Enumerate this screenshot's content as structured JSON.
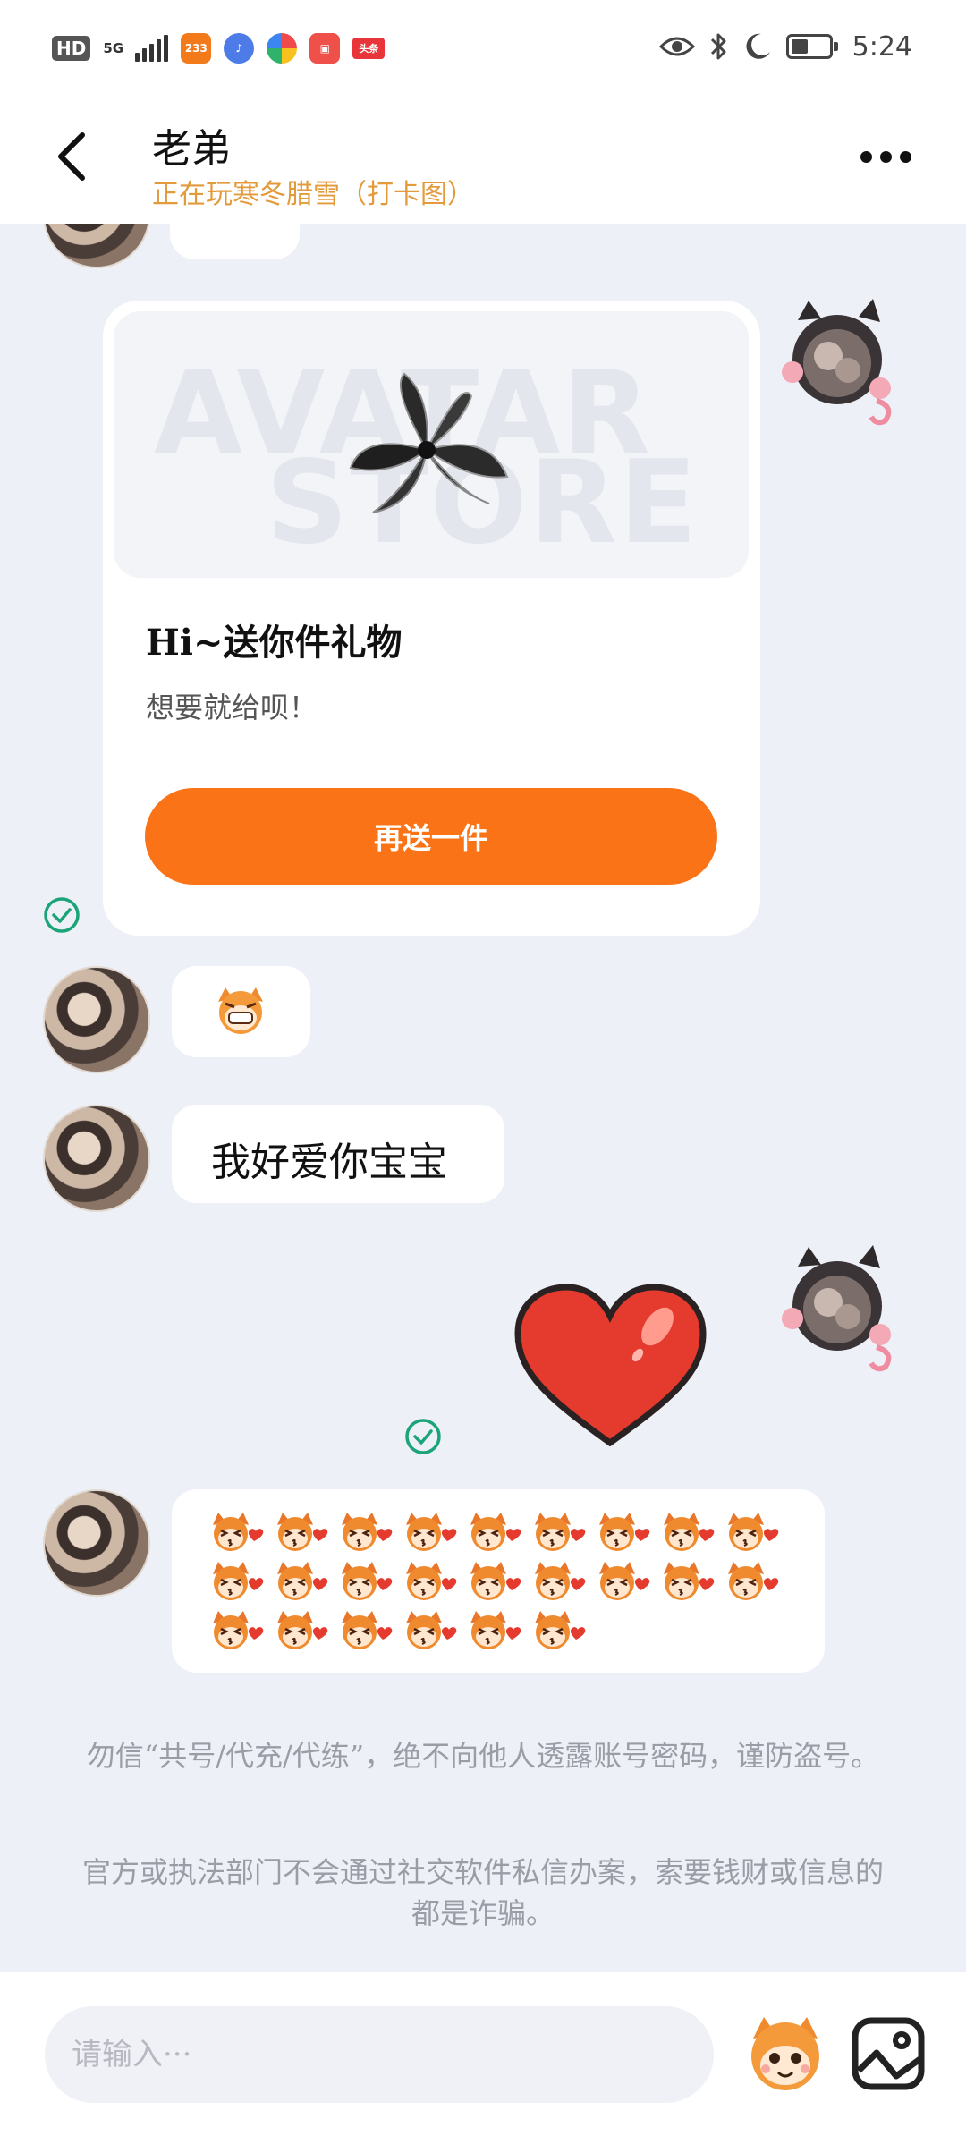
{
  "status_bar": {
    "hd": "HD",
    "network": "5G",
    "app_badges": [
      "233",
      "头条"
    ],
    "time": "5:24",
    "battery_level": 0.45
  },
  "header": {
    "title": "老弟",
    "subtitle": "正在玩寒冬腊雪（打卡图）"
  },
  "gift_card": {
    "watermark_line1": "AVATAR",
    "watermark_line2": "STORE",
    "title": "Hi~送你件礼物",
    "description": "想要就给呗！",
    "button_label": "再送一件"
  },
  "messages": {
    "love_text": "我好爱你宝宝",
    "emoji_count": 24
  },
  "notices": {
    "line1": "勿信“共号/代充/代练”，绝不向他人透露账号密码，谨防盗号。",
    "line2": "官方或执法部门不会通过社交软件私信办案，索要钱财或信息的都是诈骗。"
  },
  "input": {
    "placeholder": "请输入···"
  },
  "colors": {
    "accent": "#fa7316",
    "subtitle": "#e39a3a",
    "check": "#1aa478",
    "background": "#eef0f8"
  },
  "icons": [
    "back-arrow-icon",
    "more-icon",
    "check-icon",
    "emoji-sticker-icon",
    "image-icon",
    "eye-icon",
    "bluetooth-icon",
    "moon-icon",
    "battery-icon",
    "heart-sticker"
  ]
}
